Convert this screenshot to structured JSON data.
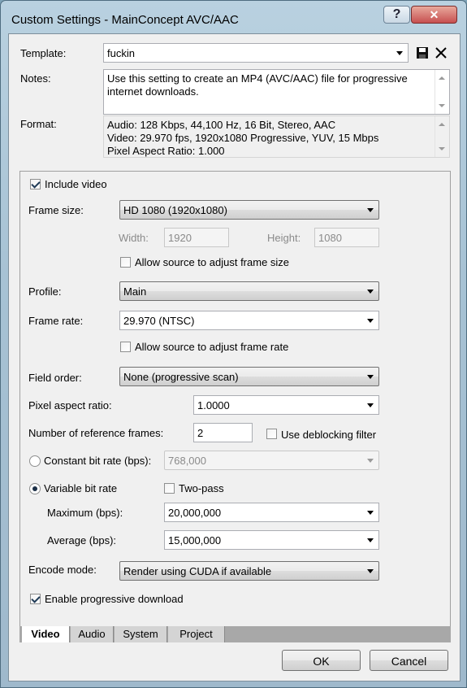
{
  "window": {
    "title": "Custom Settings - MainConcept AVC/AAC",
    "help_glyph": "?",
    "close_glyph": "✕"
  },
  "template": {
    "label": "Template:",
    "value": "fuckin"
  },
  "notes": {
    "label": "Notes:",
    "text": "Use this setting to create an MP4 (AVC/AAC) file for progressive internet downloads."
  },
  "format": {
    "label": "Format:",
    "lines": [
      "Audio: 128 Kbps, 44,100 Hz, 16 Bit, Stereo, AAC",
      "Video: 29.970 fps, 1920x1080 Progressive, YUV, 15 Mbps",
      "Pixel Aspect Ratio: 1.000"
    ]
  },
  "video": {
    "include_video": {
      "label": "Include video",
      "checked": true
    },
    "frame_size": {
      "label": "Frame size:",
      "value": "HD 1080 (1920x1080)"
    },
    "width": {
      "label": "Width:",
      "value": "1920"
    },
    "height": {
      "label": "Height:",
      "value": "1080"
    },
    "allow_frame_size": {
      "label": "Allow source to adjust frame size",
      "checked": false
    },
    "profile": {
      "label": "Profile:",
      "value": "Main"
    },
    "frame_rate": {
      "label": "Frame rate:",
      "value": "29.970 (NTSC)"
    },
    "allow_frame_rate": {
      "label": "Allow source to adjust frame rate",
      "checked": false
    },
    "field_order": {
      "label": "Field order:",
      "value": "None (progressive scan)"
    },
    "pixel_aspect": {
      "label": "Pixel aspect ratio:",
      "value": "1.0000"
    },
    "ref_frames": {
      "label": "Number of reference frames:",
      "value": "2"
    },
    "deblocking": {
      "label": "Use deblocking filter",
      "checked": false
    },
    "cbr": {
      "label": "Constant bit rate (bps):",
      "value": "768,000",
      "selected": false
    },
    "vbr": {
      "label": "Variable bit rate",
      "selected": true
    },
    "two_pass": {
      "label": "Two-pass",
      "checked": false
    },
    "maximum": {
      "label": "Maximum (bps):",
      "value": "20,000,000"
    },
    "average": {
      "label": "Average (bps):",
      "value": "15,000,000"
    },
    "encode_mode": {
      "label": "Encode mode:",
      "value": "Render using CUDA if available"
    },
    "progressive_download": {
      "label": "Enable progressive download",
      "checked": true
    }
  },
  "tabs": [
    "Video",
    "Audio",
    "System",
    "Project"
  ],
  "buttons": {
    "ok": "OK",
    "cancel": "Cancel"
  },
  "colors": {
    "title_bar": "#b9d1e0",
    "dialog_bg": "#f0f0f0",
    "close_red": "#c75050"
  }
}
